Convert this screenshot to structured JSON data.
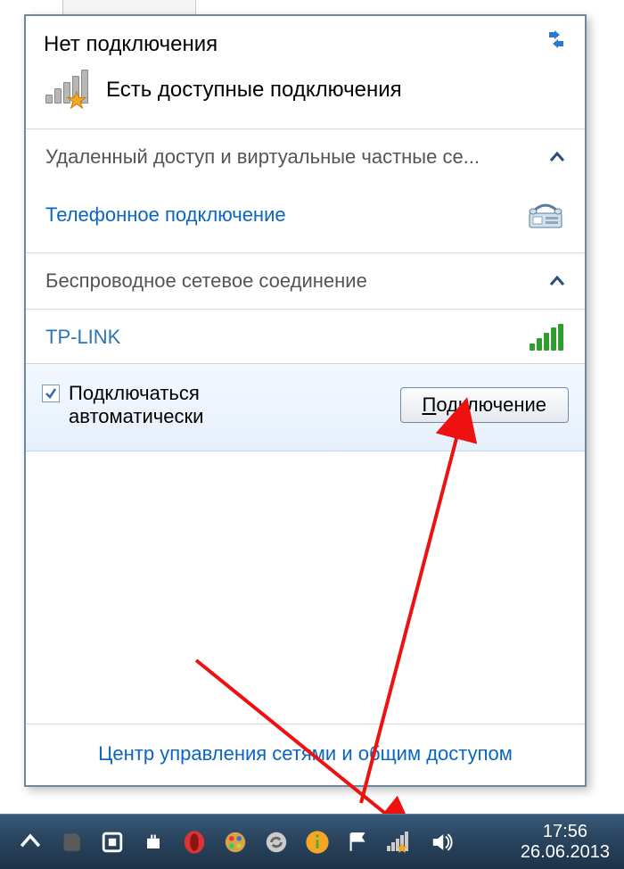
{
  "popup": {
    "title": "Нет подключения",
    "available_text": "Есть доступные подключения",
    "section_dialup": "Удаленный доступ и виртуальные частные се...",
    "dialup_link": "Телефонное подключение",
    "section_wireless": "Беспроводное сетевое соединение",
    "network_name": "TP-LINK",
    "auto_connect_label": "Подключаться автоматически",
    "auto_connect_checked": true,
    "connect_button": "Подключение",
    "connect_button_underline_first": "П",
    "connect_button_rest": "одключение",
    "footer_link": "Центр управления сетями и общим доступом"
  },
  "taskbar": {
    "time": "17:56",
    "date": "26.06.2013"
  }
}
